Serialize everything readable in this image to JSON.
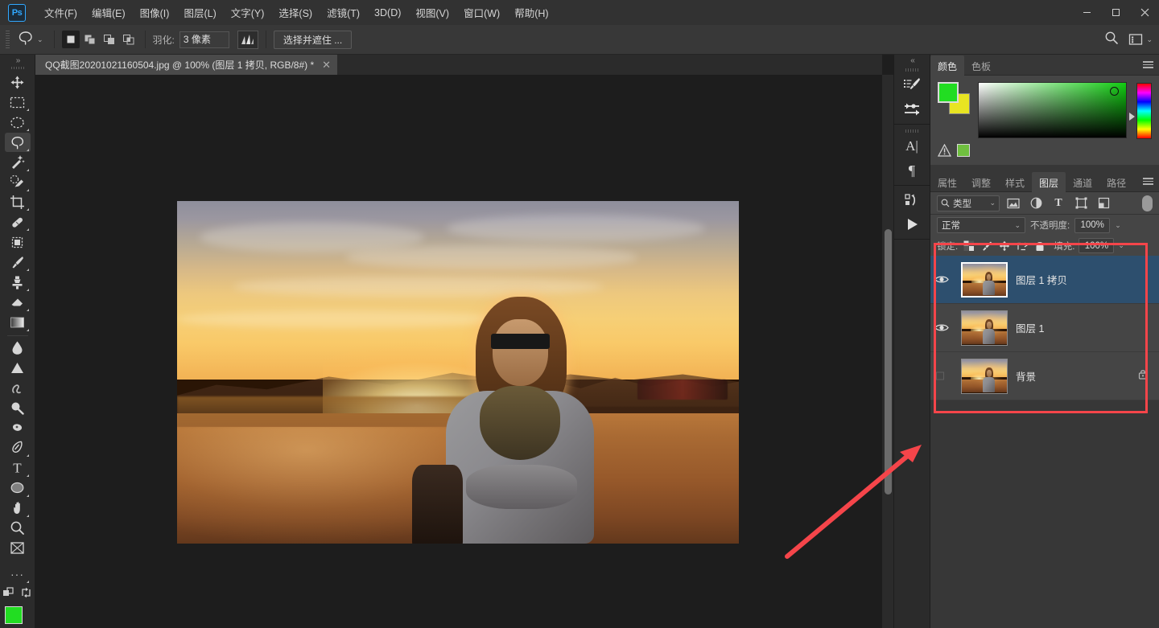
{
  "app": {
    "name": "Ps",
    "accent": "#31a8ff"
  },
  "menubar": {
    "items": [
      {
        "label": "文件(F)"
      },
      {
        "label": "编辑(E)"
      },
      {
        "label": "图像(I)"
      },
      {
        "label": "图层(L)"
      },
      {
        "label": "文字(Y)"
      },
      {
        "label": "选择(S)"
      },
      {
        "label": "滤镜(T)"
      },
      {
        "label": "3D(D)"
      },
      {
        "label": "视图(V)"
      },
      {
        "label": "窗口(W)"
      },
      {
        "label": "帮助(H)"
      }
    ],
    "window_controls": {
      "minimize": "—",
      "maximize": "▢",
      "close": "✕"
    }
  },
  "options_bar": {
    "tool_icon": "lasso-tool-icon",
    "tool_preset_chevron": "⌄",
    "selection_modes": [
      {
        "name": "new-selection",
        "active": true
      },
      {
        "name": "add-to-selection",
        "active": false
      },
      {
        "name": "subtract-from-selection",
        "active": false
      },
      {
        "name": "intersect-selection",
        "active": false
      }
    ],
    "feather_label": "羽化:",
    "feather_value": "3 像素",
    "antialias_icon": "anti-alias-icon",
    "select_and_mask_label": "选择并遮住 ...",
    "search_icon": "search-icon",
    "workspace_icon": "workspace-switcher-icon",
    "workspace_chevron": "⌄"
  },
  "document_tab": {
    "title": "QQ截图20201021160504.jpg @ 100% (图层 1 拷贝, RGB/8#) *",
    "close": "✕"
  },
  "toolbar": {
    "expand_chevron": "»",
    "tools": [
      {
        "name": "move-tool",
        "active": false,
        "has_submenu": false
      },
      {
        "name": "rectangular-marquee-tool",
        "active": false,
        "has_submenu": true
      },
      {
        "name": "elliptical-marquee-tool",
        "active": false,
        "has_submenu": true
      },
      {
        "name": "lasso-tool",
        "active": true,
        "has_submenu": true
      },
      {
        "name": "magic-wand-tool",
        "active": false,
        "has_submenu": true
      },
      {
        "name": "quick-selection-tool",
        "active": false,
        "has_submenu": true
      },
      {
        "name": "crop-tool",
        "active": false,
        "has_submenu": true
      },
      {
        "name": "healing-brush-tool",
        "active": false,
        "has_submenu": true
      },
      {
        "name": "frame-tool",
        "active": false,
        "has_submenu": false
      },
      {
        "name": "brush-tool",
        "active": false,
        "has_submenu": true
      },
      {
        "name": "clone-stamp-tool",
        "active": false,
        "has_submenu": true
      },
      {
        "name": "eraser-tool",
        "active": false,
        "has_submenu": true
      },
      {
        "name": "gradient-tool",
        "active": false,
        "has_submenu": true
      },
      {
        "name": "blur-tool",
        "active": false,
        "has_submenu": true
      },
      {
        "name": "dodge-tool",
        "active": false,
        "has_submenu": true
      },
      {
        "name": "smudge-tool",
        "active": false,
        "has_submenu": true
      },
      {
        "name": "burn-tool",
        "active": false,
        "has_submenu": true
      },
      {
        "name": "sponge-tool",
        "active": false,
        "has_submenu": true
      },
      {
        "name": "pen-tool",
        "active": false,
        "has_submenu": true
      },
      {
        "name": "type-tool",
        "active": false,
        "has_submenu": true
      },
      {
        "name": "ellipse-shape-tool",
        "active": false,
        "has_submenu": true
      },
      {
        "name": "hand-tool",
        "active": false,
        "has_submenu": true
      },
      {
        "name": "zoom-tool",
        "active": false,
        "has_submenu": false
      },
      {
        "name": "artboard-tool",
        "active": false,
        "has_submenu": false
      }
    ],
    "more_tools": "···",
    "screen_mode_icon": "screen-mode-icon",
    "swap_colors_icon": "swap-colors-icon",
    "foreground_color": "#22dd22",
    "background_color": "#e8e422"
  },
  "right_rail": {
    "collapse_chevron": "«",
    "icons": [
      {
        "name": "brush-settings-icon"
      },
      {
        "name": "adjustments-sliders-icon"
      },
      {
        "name": "character-panel-icon",
        "glyph": "A|"
      },
      {
        "name": "paragraph-panel-icon",
        "glyph": "¶"
      },
      {
        "name": "actions-panel-icon"
      },
      {
        "name": "play-action-icon",
        "glyph": "▶"
      }
    ]
  },
  "color_panel": {
    "tabs": [
      {
        "label": "颜色",
        "active": true
      },
      {
        "label": "色板",
        "active": false
      }
    ],
    "menu_icon": "panel-menu-icon",
    "foreground_color": "#22dd22",
    "background_color": "#e8e422",
    "gamut_warning_icon": "gamut-warning-icon",
    "gamut_color": "#6fbf3f",
    "field_marker": "color-picker-marker",
    "hue_slider": "hue-slider"
  },
  "layers_panel": {
    "tabs": [
      {
        "label": "属性",
        "active": false
      },
      {
        "label": "调整",
        "active": false
      },
      {
        "label": "样式",
        "active": false
      },
      {
        "label": "图层",
        "active": true
      },
      {
        "label": "通道",
        "active": false
      },
      {
        "label": "路径",
        "active": false
      }
    ],
    "menu_icon": "panel-menu-icon",
    "filter": {
      "search_icon": "search-icon",
      "kind_label": "类型",
      "chevron": "⌄",
      "filter_icons": [
        {
          "name": "filter-pixel-layers-icon"
        },
        {
          "name": "filter-adjustment-layers-icon"
        },
        {
          "name": "filter-type-layers-icon"
        },
        {
          "name": "filter-shape-layers-icon"
        },
        {
          "name": "filter-smart-object-icon"
        }
      ],
      "toggle_name": "filter-toggle-switch"
    },
    "blend_mode": "正常",
    "blend_chevron": "⌄",
    "opacity_label": "不透明度:",
    "opacity_value": "100%",
    "opacity_chevron": "⌄",
    "lock_label": "锁定:",
    "lock_icons": [
      {
        "name": "lock-transparent-pixels-icon"
      },
      {
        "name": "lock-image-pixels-icon"
      },
      {
        "name": "lock-position-icon"
      },
      {
        "name": "lock-artboard-nesting-icon"
      },
      {
        "name": "lock-all-icon"
      }
    ],
    "fill_label": "填充:",
    "fill_value": "100%",
    "fill_chevron": "⌄",
    "layers": [
      {
        "name": "图层 1 拷贝",
        "visible": true,
        "selected": true,
        "locked": false
      },
      {
        "name": "图层 1",
        "visible": true,
        "selected": false,
        "locked": false
      },
      {
        "name": "背景",
        "visible": false,
        "selected": false,
        "locked": true,
        "lock_icon": "lock-icon"
      }
    ]
  },
  "annotations": {
    "highlight_box_color": "#f5454a",
    "arrow_color": "#f5454a",
    "arrow_name": "red-pointer-arrow",
    "box_name": "red-highlight-rectangle"
  },
  "canvas": {
    "scrollbar_name": "canvas-vertical-scrollbar",
    "image_alt": "sunset-portrait-photo"
  }
}
